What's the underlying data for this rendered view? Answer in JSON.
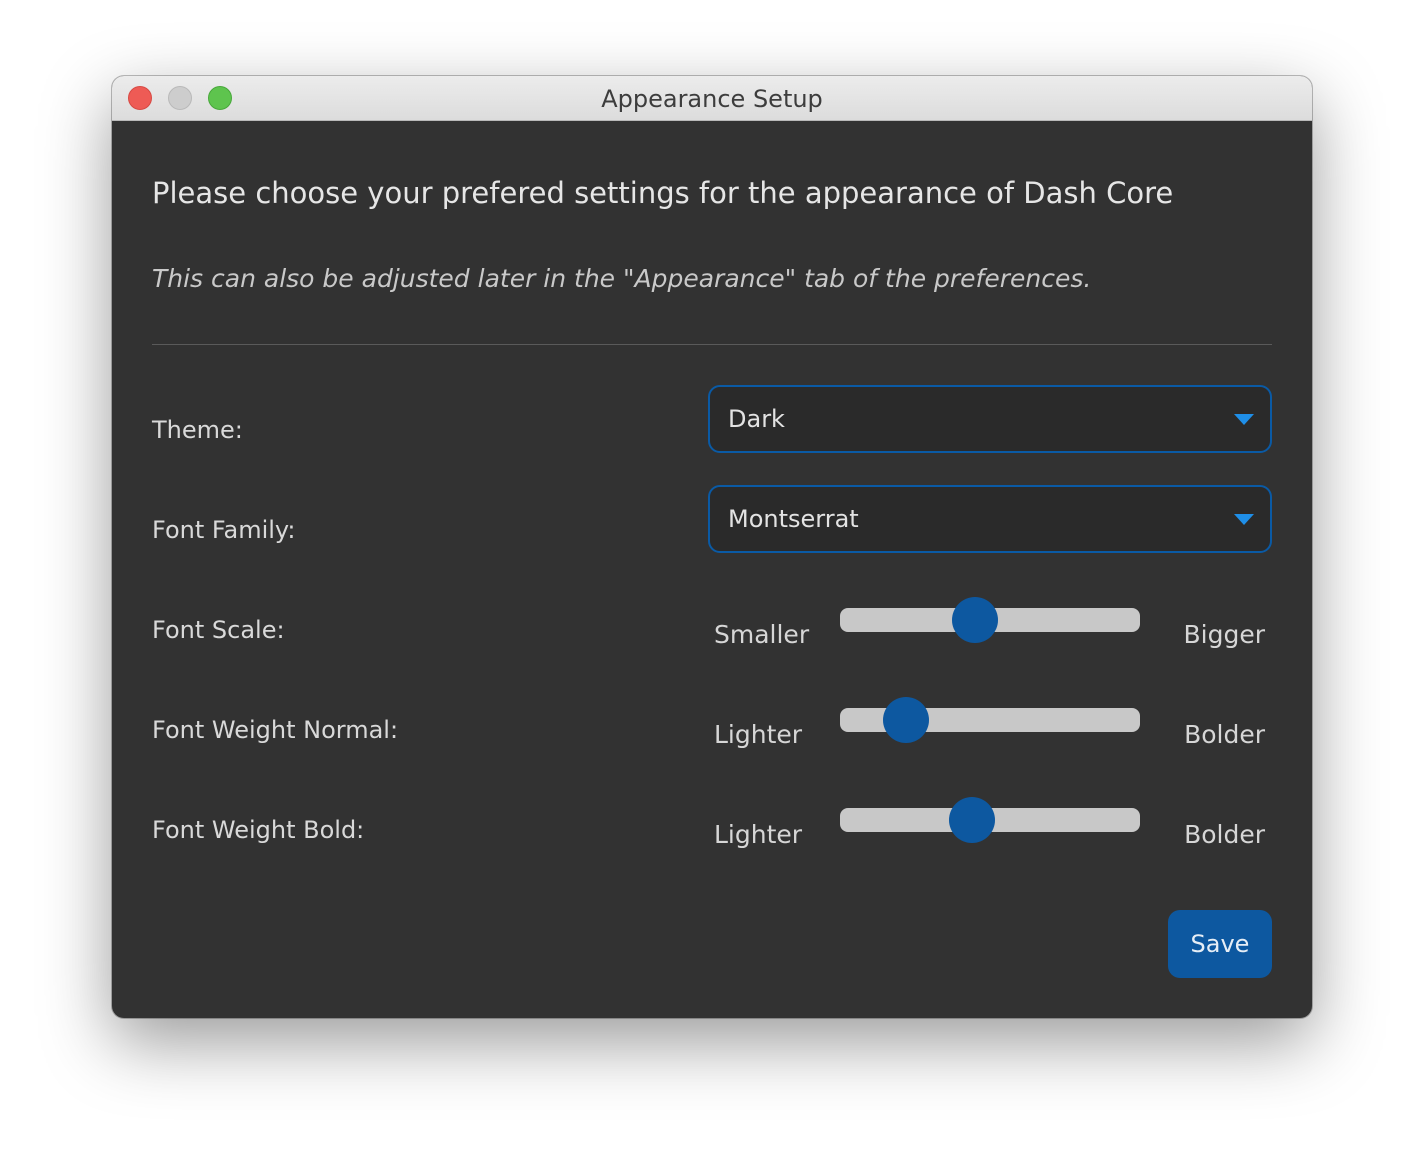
{
  "window": {
    "title": "Appearance Setup"
  },
  "header": {
    "heading": "Please choose your prefered settings for the appearance of Dash Core",
    "subtitle": "This can also be adjusted later in the \"Appearance\" tab of the preferences."
  },
  "settings": {
    "theme": {
      "label": "Theme:",
      "value": "Dark"
    },
    "font_family": {
      "label": "Font Family:",
      "value": "Montserrat"
    },
    "font_scale": {
      "label": "Font Scale:",
      "min_label": "Smaller",
      "max_label": "Bigger",
      "level": 0.45
    },
    "font_weight_normal": {
      "label": "Font Weight Normal:",
      "min_label": "Lighter",
      "max_label": "Bolder",
      "level": 0.22
    },
    "font_weight_bold": {
      "label": "Font Weight Bold:",
      "min_label": "Lighter",
      "max_label": "Bolder",
      "level": 0.44
    }
  },
  "actions": {
    "save_label": "Save"
  },
  "colors": {
    "accent": "#0d58a0",
    "dropdown_arrow": "#1f8fe8",
    "background": "#323232",
    "track": "#c8c8c8"
  },
  "icons": {
    "dropdown": "chevron-down-icon"
  }
}
